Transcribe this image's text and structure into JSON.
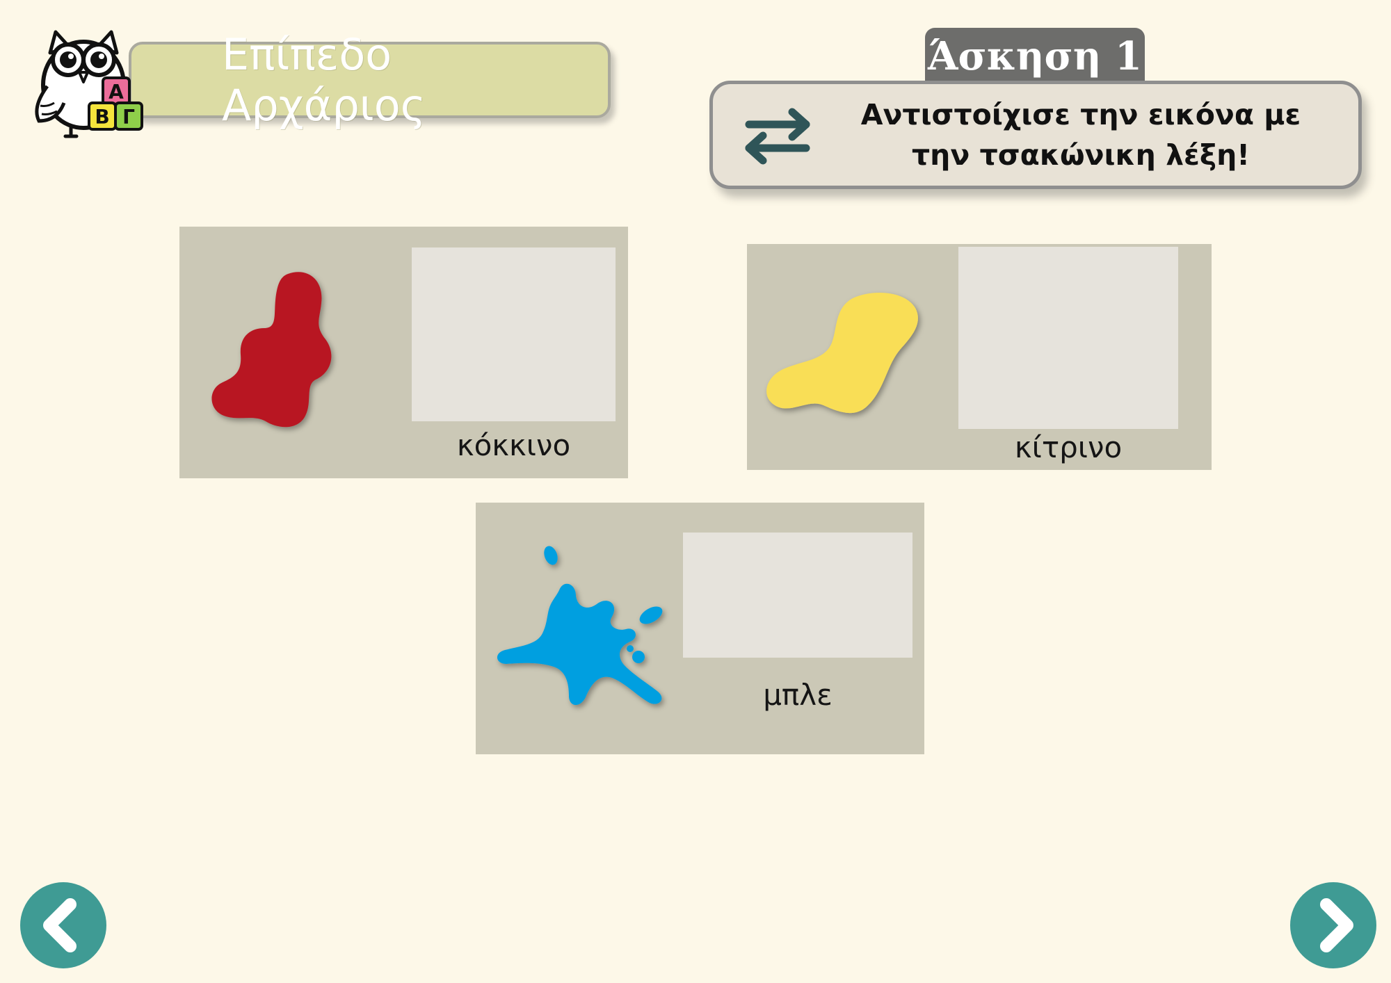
{
  "header": {
    "level_title": "Επίπεδο Αρχάριος",
    "logo_letters": [
      "Α",
      "Β",
      "Γ"
    ],
    "exercise_label": "Άσκηση 1",
    "instruction": "Αντιστοίχισε την εικόνα με την τσακώνικη λέξη!",
    "instruction_icon": "swap-arrows-icon"
  },
  "cards": [
    {
      "id": "red",
      "word": "κόκκινο",
      "image": "red-blob",
      "color": "#b81823"
    },
    {
      "id": "yellow",
      "word": "κίτρινο",
      "image": "yellow-blob",
      "color": "#f9de57"
    },
    {
      "id": "blue",
      "word": "μπλε",
      "image": "blue-splash",
      "color": "#069fe0"
    }
  ],
  "navigation": {
    "prev_icon": "chevron-left-icon",
    "next_icon": "chevron-right-icon"
  },
  "colors": {
    "background": "#fdf8e8",
    "banner": "#dcdca4",
    "card": "#cbc8b6",
    "drop_zone": "#e6e3dc",
    "accent": "#3f9b94",
    "exercise_tab": "#6d6d6b"
  }
}
